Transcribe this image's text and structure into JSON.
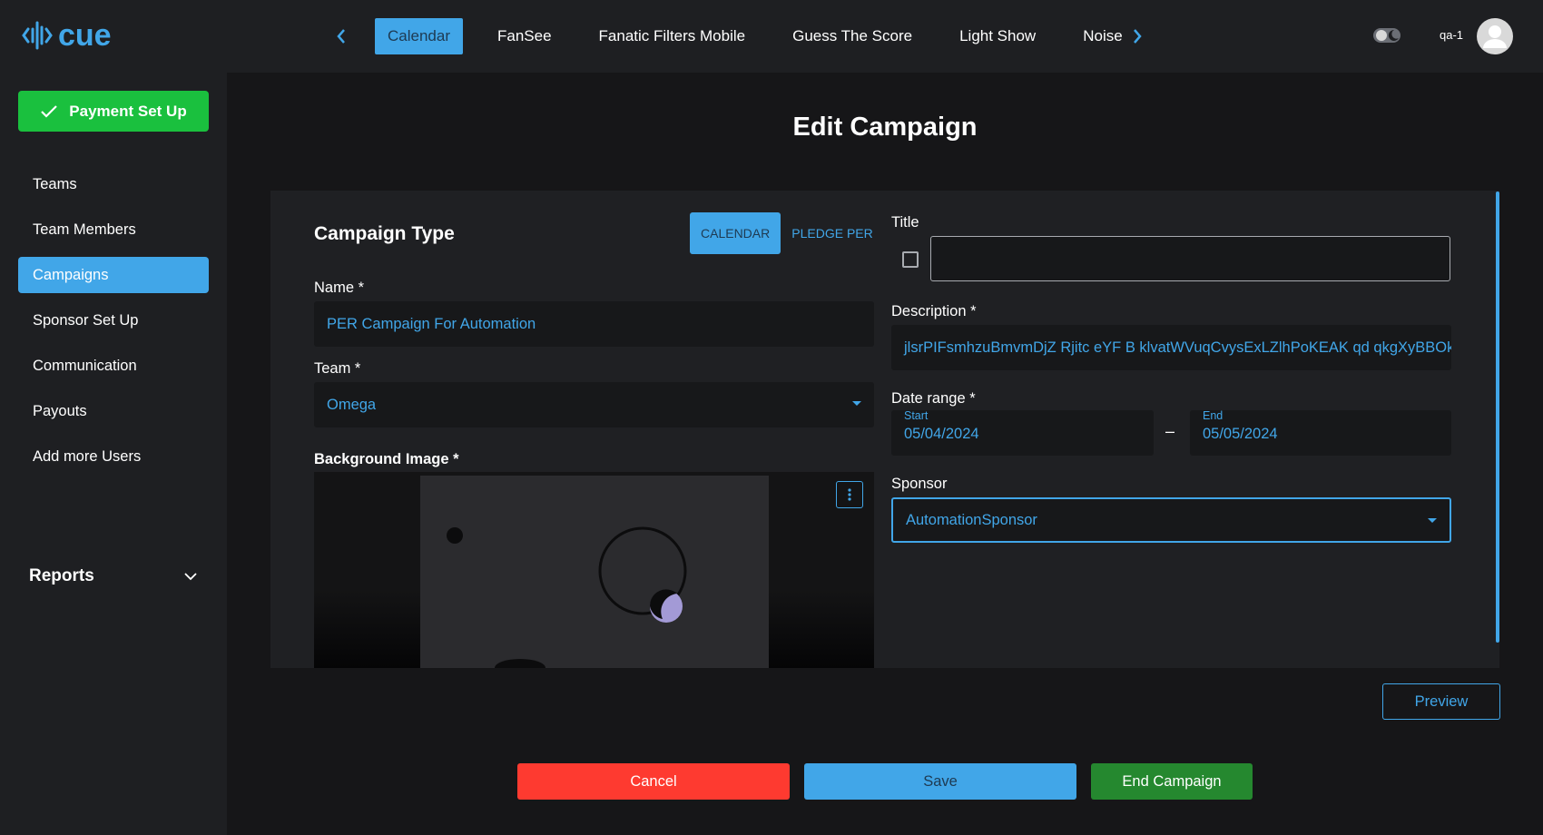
{
  "app": {
    "logo_text": "cue"
  },
  "nav": {
    "tabs": [
      {
        "label": "Calendar",
        "active": true
      },
      {
        "label": "FanSee",
        "active": false
      },
      {
        "label": "Fanatic Filters Mobile",
        "active": false
      },
      {
        "label": "Guess The Score",
        "active": false
      },
      {
        "label": "Light Show",
        "active": false
      },
      {
        "label": "Noise",
        "active": false
      }
    ],
    "user_name": "qa-1"
  },
  "sidebar": {
    "payment_button": "Payment Set Up",
    "items": [
      {
        "label": "Teams",
        "active": false
      },
      {
        "label": "Team Members",
        "active": false
      },
      {
        "label": "Campaigns",
        "active": true
      },
      {
        "label": "Sponsor Set Up",
        "active": false
      },
      {
        "label": "Communication",
        "active": false
      },
      {
        "label": "Payouts",
        "active": false
      },
      {
        "label": "Add more Users",
        "active": false
      }
    ],
    "reports_label": "Reports"
  },
  "main": {
    "page_title": "Edit Campaign",
    "campaign_type": {
      "title": "Campaign Type",
      "options": [
        {
          "label": "CALENDAR",
          "active": true
        },
        {
          "label": "PLEDGE PER",
          "active": false
        }
      ]
    },
    "name": {
      "label": "Name *",
      "value": "PER Campaign For Automation"
    },
    "team": {
      "label": "Team *",
      "value": "Omega"
    },
    "background_image": {
      "label": "Background Image *"
    },
    "title": {
      "label": "Title",
      "value": "",
      "checked": false
    },
    "description": {
      "label": "Description *",
      "value": "jlsrPIFsmhzuBmvmDjZ Rjitc eYF B klvatWVuqCvysExLZlhPoKEAK qd qkgXyBBOkfTsAW"
    },
    "date_range": {
      "label": "Date range *",
      "start_label": "Start",
      "start_value": "05/04/2024",
      "separator": "–",
      "end_label": "End",
      "end_value": "05/05/2024"
    },
    "sponsor": {
      "label": "Sponsor",
      "value": "AutomationSponsor"
    },
    "buttons": {
      "preview": "Preview",
      "cancel": "Cancel",
      "save": "Save",
      "end_campaign": "End Campaign"
    }
  },
  "colors": {
    "accent": "#41a6e8",
    "success": "#1ac03e",
    "danger": "#fe3a30",
    "end_campaign": "#25882f",
    "background": "#161618",
    "card": "#1f2023"
  }
}
